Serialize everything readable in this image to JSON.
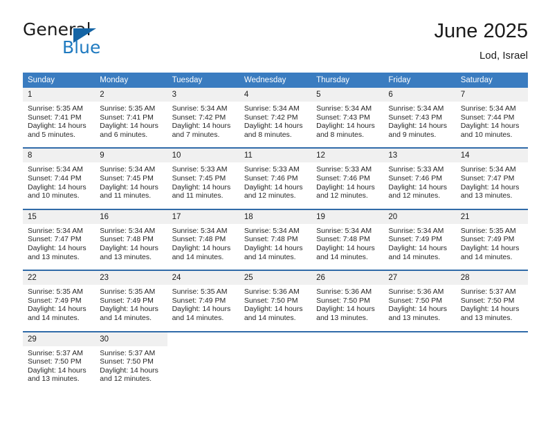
{
  "brand": {
    "name_part1": "General",
    "name_part2": "Blue",
    "flag_icon": "triangle-flag-icon",
    "accent_color": "#1f7ac0",
    "flag_color": "#1464a5"
  },
  "header": {
    "title": "June 2025",
    "subtitle": "Lod, Israel"
  },
  "calendar": {
    "header_bg": "#3a7cc0",
    "daynum_bg": "#f0f0f0",
    "row_divider_color": "#2f6aa8",
    "weekdays": [
      "Sunday",
      "Monday",
      "Tuesday",
      "Wednesday",
      "Thursday",
      "Friday",
      "Saturday"
    ],
    "weeks": [
      [
        {
          "day": "1",
          "sunrise": "Sunrise: 5:35 AM",
          "sunset": "Sunset: 7:41 PM",
          "daylight_line1": "Daylight: 14 hours",
          "daylight_line2": "and 5 minutes."
        },
        {
          "day": "2",
          "sunrise": "Sunrise: 5:35 AM",
          "sunset": "Sunset: 7:41 PM",
          "daylight_line1": "Daylight: 14 hours",
          "daylight_line2": "and 6 minutes."
        },
        {
          "day": "3",
          "sunrise": "Sunrise: 5:34 AM",
          "sunset": "Sunset: 7:42 PM",
          "daylight_line1": "Daylight: 14 hours",
          "daylight_line2": "and 7 minutes."
        },
        {
          "day": "4",
          "sunrise": "Sunrise: 5:34 AM",
          "sunset": "Sunset: 7:42 PM",
          "daylight_line1": "Daylight: 14 hours",
          "daylight_line2": "and 8 minutes."
        },
        {
          "day": "5",
          "sunrise": "Sunrise: 5:34 AM",
          "sunset": "Sunset: 7:43 PM",
          "daylight_line1": "Daylight: 14 hours",
          "daylight_line2": "and 8 minutes."
        },
        {
          "day": "6",
          "sunrise": "Sunrise: 5:34 AM",
          "sunset": "Sunset: 7:43 PM",
          "daylight_line1": "Daylight: 14 hours",
          "daylight_line2": "and 9 minutes."
        },
        {
          "day": "7",
          "sunrise": "Sunrise: 5:34 AM",
          "sunset": "Sunset: 7:44 PM",
          "daylight_line1": "Daylight: 14 hours",
          "daylight_line2": "and 10 minutes."
        }
      ],
      [
        {
          "day": "8",
          "sunrise": "Sunrise: 5:34 AM",
          "sunset": "Sunset: 7:44 PM",
          "daylight_line1": "Daylight: 14 hours",
          "daylight_line2": "and 10 minutes."
        },
        {
          "day": "9",
          "sunrise": "Sunrise: 5:34 AM",
          "sunset": "Sunset: 7:45 PM",
          "daylight_line1": "Daylight: 14 hours",
          "daylight_line2": "and 11 minutes."
        },
        {
          "day": "10",
          "sunrise": "Sunrise: 5:33 AM",
          "sunset": "Sunset: 7:45 PM",
          "daylight_line1": "Daylight: 14 hours",
          "daylight_line2": "and 11 minutes."
        },
        {
          "day": "11",
          "sunrise": "Sunrise: 5:33 AM",
          "sunset": "Sunset: 7:46 PM",
          "daylight_line1": "Daylight: 14 hours",
          "daylight_line2": "and 12 minutes."
        },
        {
          "day": "12",
          "sunrise": "Sunrise: 5:33 AM",
          "sunset": "Sunset: 7:46 PM",
          "daylight_line1": "Daylight: 14 hours",
          "daylight_line2": "and 12 minutes."
        },
        {
          "day": "13",
          "sunrise": "Sunrise: 5:33 AM",
          "sunset": "Sunset: 7:46 PM",
          "daylight_line1": "Daylight: 14 hours",
          "daylight_line2": "and 12 minutes."
        },
        {
          "day": "14",
          "sunrise": "Sunrise: 5:34 AM",
          "sunset": "Sunset: 7:47 PM",
          "daylight_line1": "Daylight: 14 hours",
          "daylight_line2": "and 13 minutes."
        }
      ],
      [
        {
          "day": "15",
          "sunrise": "Sunrise: 5:34 AM",
          "sunset": "Sunset: 7:47 PM",
          "daylight_line1": "Daylight: 14 hours",
          "daylight_line2": "and 13 minutes."
        },
        {
          "day": "16",
          "sunrise": "Sunrise: 5:34 AM",
          "sunset": "Sunset: 7:48 PM",
          "daylight_line1": "Daylight: 14 hours",
          "daylight_line2": "and 13 minutes."
        },
        {
          "day": "17",
          "sunrise": "Sunrise: 5:34 AM",
          "sunset": "Sunset: 7:48 PM",
          "daylight_line1": "Daylight: 14 hours",
          "daylight_line2": "and 14 minutes."
        },
        {
          "day": "18",
          "sunrise": "Sunrise: 5:34 AM",
          "sunset": "Sunset: 7:48 PM",
          "daylight_line1": "Daylight: 14 hours",
          "daylight_line2": "and 14 minutes."
        },
        {
          "day": "19",
          "sunrise": "Sunrise: 5:34 AM",
          "sunset": "Sunset: 7:48 PM",
          "daylight_line1": "Daylight: 14 hours",
          "daylight_line2": "and 14 minutes."
        },
        {
          "day": "20",
          "sunrise": "Sunrise: 5:34 AM",
          "sunset": "Sunset: 7:49 PM",
          "daylight_line1": "Daylight: 14 hours",
          "daylight_line2": "and 14 minutes."
        },
        {
          "day": "21",
          "sunrise": "Sunrise: 5:35 AM",
          "sunset": "Sunset: 7:49 PM",
          "daylight_line1": "Daylight: 14 hours",
          "daylight_line2": "and 14 minutes."
        }
      ],
      [
        {
          "day": "22",
          "sunrise": "Sunrise: 5:35 AM",
          "sunset": "Sunset: 7:49 PM",
          "daylight_line1": "Daylight: 14 hours",
          "daylight_line2": "and 14 minutes."
        },
        {
          "day": "23",
          "sunrise": "Sunrise: 5:35 AM",
          "sunset": "Sunset: 7:49 PM",
          "daylight_line1": "Daylight: 14 hours",
          "daylight_line2": "and 14 minutes."
        },
        {
          "day": "24",
          "sunrise": "Sunrise: 5:35 AM",
          "sunset": "Sunset: 7:49 PM",
          "daylight_line1": "Daylight: 14 hours",
          "daylight_line2": "and 14 minutes."
        },
        {
          "day": "25",
          "sunrise": "Sunrise: 5:36 AM",
          "sunset": "Sunset: 7:50 PM",
          "daylight_line1": "Daylight: 14 hours",
          "daylight_line2": "and 14 minutes."
        },
        {
          "day": "26",
          "sunrise": "Sunrise: 5:36 AM",
          "sunset": "Sunset: 7:50 PM",
          "daylight_line1": "Daylight: 14 hours",
          "daylight_line2": "and 13 minutes."
        },
        {
          "day": "27",
          "sunrise": "Sunrise: 5:36 AM",
          "sunset": "Sunset: 7:50 PM",
          "daylight_line1": "Daylight: 14 hours",
          "daylight_line2": "and 13 minutes."
        },
        {
          "day": "28",
          "sunrise": "Sunrise: 5:37 AM",
          "sunset": "Sunset: 7:50 PM",
          "daylight_line1": "Daylight: 14 hours",
          "daylight_line2": "and 13 minutes."
        }
      ],
      [
        {
          "day": "29",
          "sunrise": "Sunrise: 5:37 AM",
          "sunset": "Sunset: 7:50 PM",
          "daylight_line1": "Daylight: 14 hours",
          "daylight_line2": "and 13 minutes."
        },
        {
          "day": "30",
          "sunrise": "Sunrise: 5:37 AM",
          "sunset": "Sunset: 7:50 PM",
          "daylight_line1": "Daylight: 14 hours",
          "daylight_line2": "and 12 minutes."
        },
        {
          "day": "",
          "sunrise": "",
          "sunset": "",
          "daylight_line1": "",
          "daylight_line2": ""
        },
        {
          "day": "",
          "sunrise": "",
          "sunset": "",
          "daylight_line1": "",
          "daylight_line2": ""
        },
        {
          "day": "",
          "sunrise": "",
          "sunset": "",
          "daylight_line1": "",
          "daylight_line2": ""
        },
        {
          "day": "",
          "sunrise": "",
          "sunset": "",
          "daylight_line1": "",
          "daylight_line2": ""
        },
        {
          "day": "",
          "sunrise": "",
          "sunset": "",
          "daylight_line1": "",
          "daylight_line2": ""
        }
      ]
    ]
  }
}
